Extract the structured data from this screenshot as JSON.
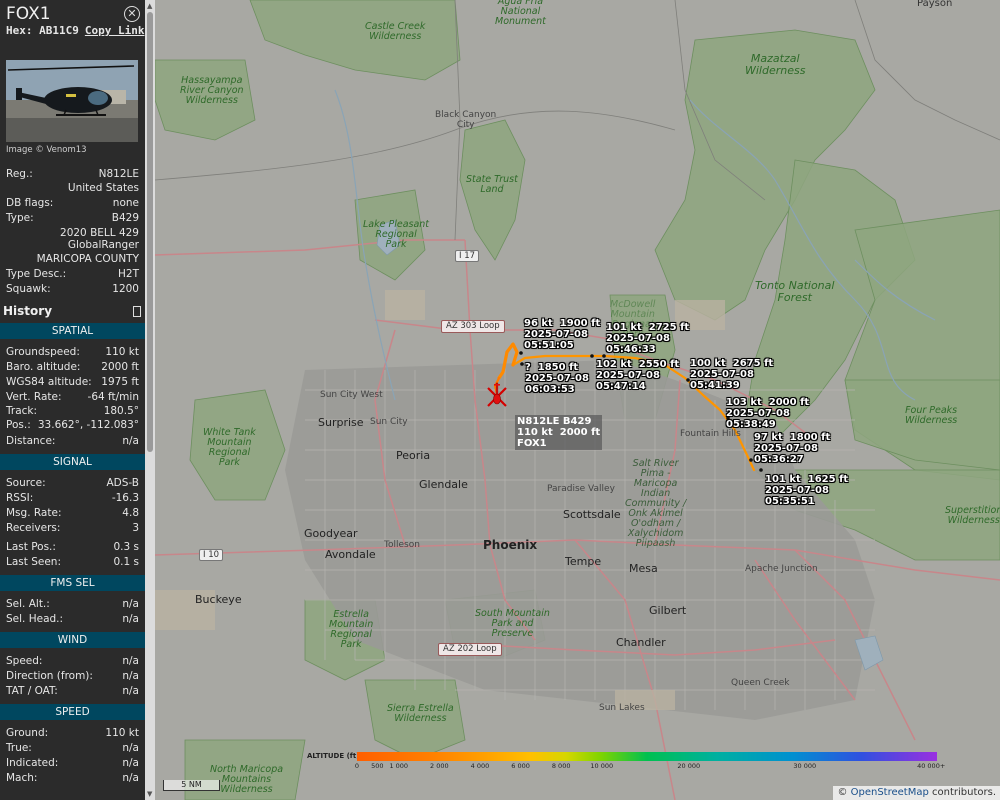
{
  "aircraft": {
    "callsign": "FOX1",
    "hex_label": "Hex:",
    "hex": "AB11C9",
    "copy_link": "Copy Link",
    "photo_credit": "Image © Venom13",
    "reg_label": "Reg.:",
    "reg": "N812LE",
    "country": "United States",
    "dbflags_label": "DB flags:",
    "dbflags": "none",
    "type_label": "Type:",
    "type": "B429",
    "model_line1": "2020 BELL 429",
    "model_line2": "GlobalRanger",
    "operator": "MARICOPA COUNTY",
    "typedesc_label": "Type Desc.:",
    "typedesc": "H2T",
    "squawk_label": "Squawk:",
    "squawk": "1200"
  },
  "history": {
    "label": "History"
  },
  "spatial": {
    "header": "SPATIAL",
    "rows": [
      {
        "k": "Groundspeed:",
        "v": "110 kt"
      },
      {
        "k": "Baro. altitude:",
        "v": "2000 ft"
      },
      {
        "k": "WGS84 altitude:",
        "v": "1975 ft"
      },
      {
        "k": "Vert. Rate:",
        "v": "-64 ft/min"
      },
      {
        "k": "Track:",
        "v": "180.5°"
      },
      {
        "k": "Pos.:",
        "v": "33.662°, -112.083°"
      },
      {
        "k": "Distance:",
        "v": "n/a"
      }
    ]
  },
  "signal": {
    "header": "SIGNAL",
    "rows": [
      {
        "k": "Source:",
        "v": "ADS-B"
      },
      {
        "k": "RSSI:",
        "v": "-16.3"
      },
      {
        "k": "Msg. Rate:",
        "v": "4.8"
      },
      {
        "k": "Receivers:",
        "v": "3"
      },
      {
        "k": "Last Pos.:",
        "v": "0.3 s"
      },
      {
        "k": "Last Seen:",
        "v": "0.1 s"
      }
    ]
  },
  "fms": {
    "header": "FMS SEL",
    "rows": [
      {
        "k": "Sel. Alt.:",
        "v": "n/a"
      },
      {
        "k": "Sel. Head.:",
        "v": "n/a"
      }
    ]
  },
  "wind": {
    "header": "WIND",
    "rows": [
      {
        "k": "Speed:",
        "v": "n/a"
      },
      {
        "k": "Direction (from):",
        "v": "n/a"
      },
      {
        "k": "TAT / OAT:",
        "v": "n/a"
      }
    ]
  },
  "speed": {
    "header": "SPEED",
    "rows": [
      {
        "k": "Ground:",
        "v": "110 kt"
      },
      {
        "k": "True:",
        "v": "n/a"
      },
      {
        "k": "Indicated:",
        "v": "n/a"
      },
      {
        "k": "Mach:",
        "v": "n/a"
      }
    ]
  },
  "map": {
    "places": {
      "payson": "Payson",
      "agua_fria": "Agua Fria\nNational\nMonument",
      "castle_creek": "Castle Creek\nWilderness",
      "mazatzal": "Mazatzal\nWilderness",
      "hassayampa": "Hassayampa\nRiver Canyon\nWilderness",
      "black_canyon": "Black Canyon\nCity",
      "state_trust": "State Trust\nLand",
      "mcdowell": "McDowell\nMountain\nRegional\nPark",
      "lake_pleasant": "Lake Pleasant\nRegional\nPark",
      "tonto": "Tonto National\nForest",
      "four_peaks": "Four Peaks\nWilderness",
      "white_tank": "White Tank\nMountain\nRegional\nPark",
      "sun_city_west": "Sun City West",
      "surprise": "Surprise",
      "sun_city": "Sun City",
      "peoria": "Peoria",
      "glendale": "Glendale",
      "fountain_hills": "Fountain Hills",
      "salt_river": "Salt River\nPima -\nMaricopa\nIndian\nCommunity /\nOnk Akimel\nO'odham /\nXalychidom\nPiipaash",
      "paradise_valley": "Paradise Valley",
      "scottsdale": "Scottsdale",
      "superstition": "Superstition\nWilderness",
      "goodyear": "Goodyear",
      "avondale": "Avondale",
      "tolleson": "Tolleson",
      "phoenix": "Phoenix",
      "tempe": "Tempe",
      "mesa": "Mesa",
      "apache_junction": "Apache Junction",
      "buckeye": "Buckeye",
      "south_mountain": "South Mountain\nPark and\nPreserve",
      "estrella": "Estrella\nMountain\nRegional\nPark",
      "gilbert": "Gilbert",
      "chandler": "Chandler",
      "queen_creek": "Queen Creek",
      "sun_lakes": "Sun Lakes",
      "sierra_estrella": "Sierra Estrella\nWilderness",
      "north_maricopa": "North Maricopa\nMountains\nWilderness"
    },
    "road_signs": {
      "az303": "AZ 303 Loop",
      "az202": "AZ 202 Loop",
      "i17": "I 17",
      "i10": "I 10"
    },
    "track_points": [
      "96 kt  1900 ft\n2025-07-08\n05:51:05",
      "101 kt  2725 ft\n2025-07-08\n05:46:33",
      "?  1850 ft\n2025-07-08\n06:03:53",
      "102 kt  2550 ft\n2025-07-08\n05:47:14",
      "100 kt  2675 ft\n2025-07-08\n05:41:39",
      "103 kt  2000 ft\n2025-07-08\n05:38:49",
      "97 kt  1800 ft\n2025-07-08\n05:36:27",
      "101 kt  1625 ft\n2025-07-08\n05:35:51"
    ],
    "aircraft_label": "N812LE B429\n110 kt  2000 ft\nFOX1",
    "legend_title": "ALTITUDE (ft)",
    "legend_ticks": [
      "0",
      "500",
      "1 000",
      "2 000",
      "4 000",
      "6 000",
      "8 000",
      "10 000",
      "20 000",
      "30 000",
      "40 000+"
    ],
    "scale": "5 NM",
    "attribution_prefix": "© ",
    "attribution_link": "OpenStreetMap",
    "attribution_suffix": " contributors."
  }
}
